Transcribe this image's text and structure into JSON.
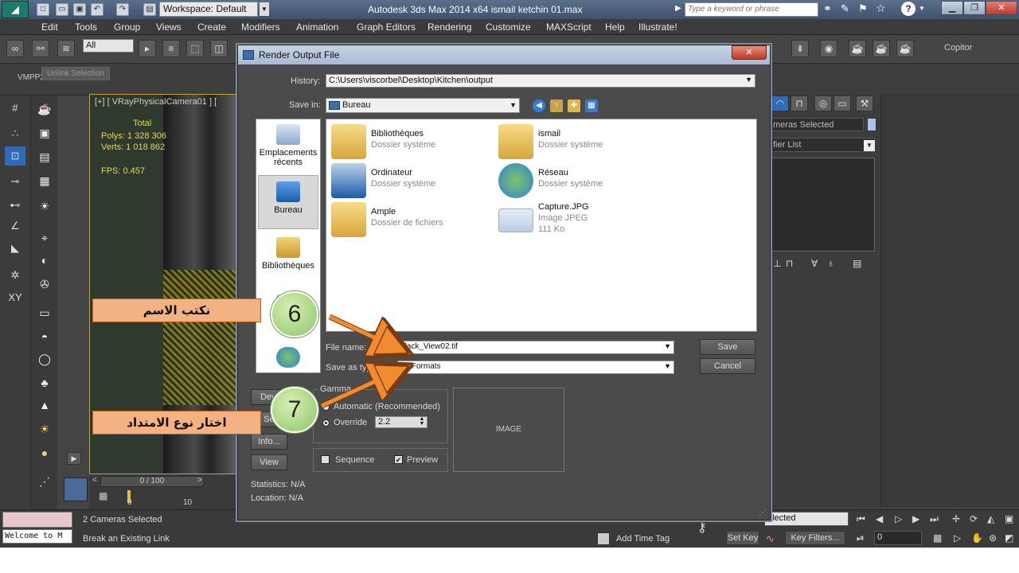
{
  "titlebar": {
    "title": "Autodesk 3ds Max  2014 x64      ismail ketchin 01.max",
    "workspace": "Workspace: Default",
    "search_placeholder": "Type a keyword or phrase"
  },
  "menubar": {
    "items": [
      "Edit",
      "Tools",
      "Group",
      "Views",
      "Create",
      "Modifiers",
      "Animation",
      "Graph Editors",
      "Rendering",
      "Customize",
      "MAXScript",
      "Help",
      "Illustrate!"
    ]
  },
  "toolbar": {
    "selection_filter": "All",
    "right_label": "Copitor"
  },
  "ribbon": {
    "vmpp_label": "VMPP26",
    "tooltip": "Unlink Selection"
  },
  "viewport": {
    "label": "[+] [ VRayPhysicalCamera01 ] [",
    "total_label": "Total",
    "polys": "Polys:  1 328 306",
    "verts": "Verts:  1 018 862",
    "fps": "FPS:    0.457",
    "timeline": "0 / 100",
    "tick_0": "0",
    "tick_10": "10"
  },
  "right_panel": {
    "selected": "meras Selected",
    "modifier_list": "fier List"
  },
  "statusbar": {
    "welcome": "Welcome to M",
    "cameras_selected": "2 Cameras Selected",
    "hint": "Break an Existing Link",
    "add_time_tag": "Add Time Tag",
    "set_key": "Set Key",
    "key_filters": "Key Filters...",
    "selected": "elected",
    "frame": "0"
  },
  "dialog": {
    "title": "Render Output File",
    "history_label": "History:",
    "history_value": "C:\\Users\\viscorbel\\Desktop\\Kitchen\\output",
    "save_in_label": "Save in:",
    "save_in_value": "Bureau",
    "places": [
      {
        "label": "Emplacements récents"
      },
      {
        "label": "Bureau"
      },
      {
        "label": "Bibliothèques"
      }
    ],
    "files": [
      {
        "name": "Bibliothèques",
        "type": "Dossier système",
        "size": ""
      },
      {
        "name": "ismail",
        "type": "Dossier système",
        "size": ""
      },
      {
        "name": "Ordinateur",
        "type": "Dossier système",
        "size": ""
      },
      {
        "name": "Réseau",
        "type": "Dossier système",
        "size": ""
      },
      {
        "name": "Ample",
        "type": "Dossier de fichiers",
        "size": ""
      },
      {
        "name": "Capture.JPG",
        "type": "Image JPEG",
        "size": "111 Ko"
      }
    ],
    "file_name_label": "File name:",
    "file_name_value": "black_View02.tif",
    "save_type_label": "Save as type:",
    "save_type_value": "All Formats",
    "save_button": "Save",
    "cancel_button": "Cancel",
    "devices_button": "Devi",
    "setup_button": "Se",
    "info_button": "Info...",
    "view_button": "View",
    "gamma_label": "Gamma",
    "gamma_auto": "Automatic (Recommended)",
    "gamma_override": "Override",
    "gamma_value": "2.2",
    "sequence_label": "Sequence",
    "preview_label": "Preview",
    "preview_checked": "✔",
    "image_label": "IMAGE",
    "statistics": "Statistics:  N/A",
    "location": "Location:  N/A"
  },
  "annotations": {
    "step1_number": "6",
    "step1_text": "نكتب  الاسم",
    "step2_number": "7",
    "step2_text": "اختار نوع الامتداد",
    "box_color": "#f4b183",
    "arrow_color": "#f28b30"
  }
}
